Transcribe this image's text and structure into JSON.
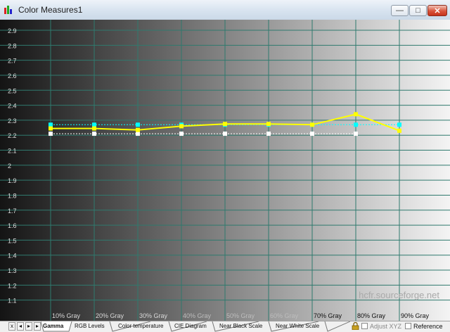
{
  "window": {
    "title": "Color Measures1",
    "minimize_label": "—",
    "restore_label": "□",
    "close_label": "✕"
  },
  "chart_data": {
    "type": "line",
    "ylim": [
      1.0,
      3.0
    ],
    "yticks": [
      "2.9",
      "2.8",
      "2.7",
      "2.6",
      "2.5",
      "2.4",
      "2.3",
      "2.2",
      "2.1",
      "2",
      "1.9",
      "1.8",
      "1.7",
      "1.6",
      "1.5",
      "1.4",
      "1.3",
      "1.2",
      "1.1"
    ],
    "categories": [
      "10% Gray",
      "20% Gray",
      "30% Gray",
      "40% Gray",
      "50% Gray",
      "60% Gray",
      "70% Gray",
      "80% Gray",
      "90% Gray"
    ],
    "grid": true,
    "watermark": "hcfr.sourceforge.net",
    "colors": {
      "measured": "#ffff00",
      "reference": "#00ffff",
      "white_ref": "#ffffff",
      "grid": "#2f7a6e"
    },
    "series": [
      {
        "values": [
          2.245,
          2.245,
          2.235,
          2.26,
          2.275,
          2.275,
          2.27,
          2.34,
          2.23
        ]
      },
      {
        "values": [
          2.27,
          2.27,
          2.27,
          2.27,
          2.27,
          2.27,
          2.27,
          2.27,
          2.27
        ]
      },
      {
        "values": [
          2.21,
          2.21,
          2.21,
          2.21,
          2.21,
          2.21,
          2.21,
          2.21
        ]
      }
    ]
  },
  "tabs": [
    "Gamma",
    "RGB Levels",
    "Color temperature",
    "CIE Diagram",
    "Near Black Scale",
    "Near White Scale"
  ],
  "active_tab": "Gamma",
  "nav": {
    "first": "x",
    "prev": "◂",
    "next": "▸",
    "last": "▸"
  },
  "options": {
    "adjust_xyz": "Adjust XYZ",
    "reference": "Reference"
  }
}
